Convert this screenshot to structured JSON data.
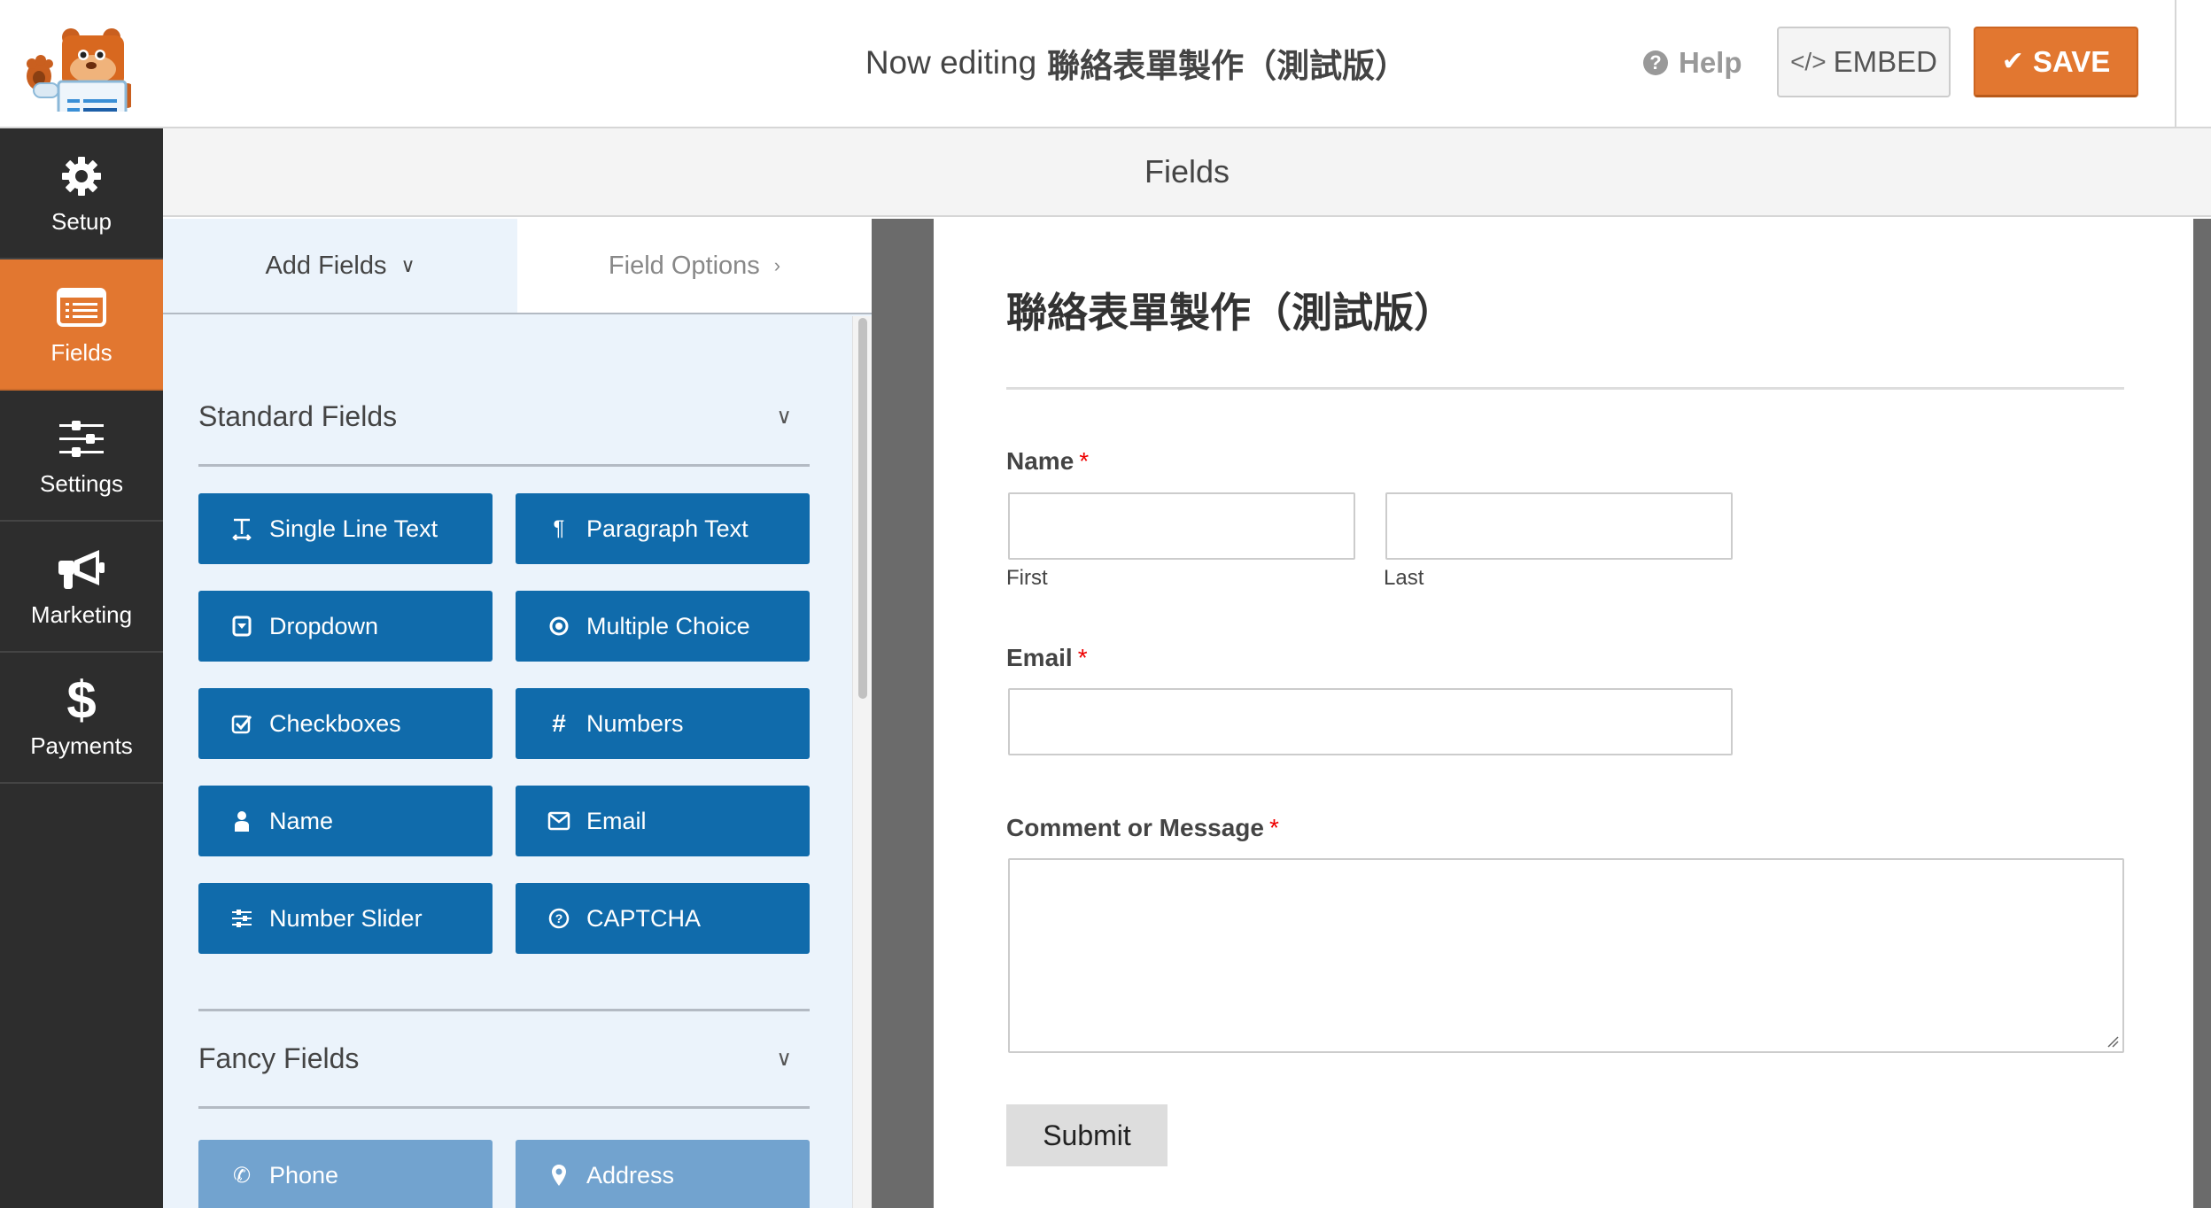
{
  "header": {
    "logo_alt": "WPForms bear mascot",
    "title_prefix": "Now editing",
    "form_name": "聯絡表單製作（測試版）",
    "help_label": "Help",
    "embed_label": "EMBED",
    "save_label": "SAVE"
  },
  "sidebar": {
    "items": [
      {
        "label": "Setup",
        "icon": "gear-icon",
        "active": false
      },
      {
        "label": "Fields",
        "icon": "list-form-icon",
        "active": true
      },
      {
        "label": "Settings",
        "icon": "sliders-icon",
        "active": false
      },
      {
        "label": "Marketing",
        "icon": "megaphone-icon",
        "active": false
      },
      {
        "label": "Payments",
        "icon": "dollar-icon",
        "active": false
      }
    ]
  },
  "fields_bar": {
    "title": "Fields"
  },
  "panel": {
    "tabs": [
      {
        "label": "Add Fields",
        "active": true
      },
      {
        "label": "Field Options",
        "active": false
      }
    ],
    "standard_section": {
      "title": "Standard Fields",
      "buttons": [
        {
          "label": "Single Line Text",
          "icon": "text-cursor-icon"
        },
        {
          "label": "Paragraph Text",
          "icon": "paragraph-icon"
        },
        {
          "label": "Dropdown",
          "icon": "dropdown-icon"
        },
        {
          "label": "Multiple Choice",
          "icon": "radio-icon"
        },
        {
          "label": "Checkboxes",
          "icon": "checkbox-icon"
        },
        {
          "label": "Numbers",
          "icon": "hash-icon"
        },
        {
          "label": "Name",
          "icon": "user-icon"
        },
        {
          "label": "Email",
          "icon": "envelope-icon"
        },
        {
          "label": "Number Slider",
          "icon": "slider-icon"
        },
        {
          "label": "CAPTCHA",
          "icon": "question-circle-icon"
        }
      ]
    },
    "fancy_section": {
      "title": "Fancy Fields",
      "buttons": [
        {
          "label": "Phone",
          "icon": "phone-icon"
        },
        {
          "label": "Address",
          "icon": "map-pin-icon"
        }
      ]
    }
  },
  "form": {
    "title": "聯絡表單製作（測試版）",
    "fields": {
      "name": {
        "label": "Name",
        "required_mark": "*",
        "first_sublabel": "First",
        "last_sublabel": "Last",
        "first_value": "",
        "last_value": ""
      },
      "email": {
        "label": "Email",
        "required_mark": "*",
        "value": ""
      },
      "message": {
        "label": "Comment or Message",
        "required_mark": "*",
        "value": ""
      }
    },
    "submit_label": "Submit"
  },
  "colors": {
    "accent_orange": "#e27730",
    "field_button_blue": "#106bab",
    "fancy_button_blue": "#72a3cf",
    "sidebar_dark": "#2d2d2d",
    "panel_bg": "#ebf3fb",
    "required_red": "#ee0000"
  }
}
